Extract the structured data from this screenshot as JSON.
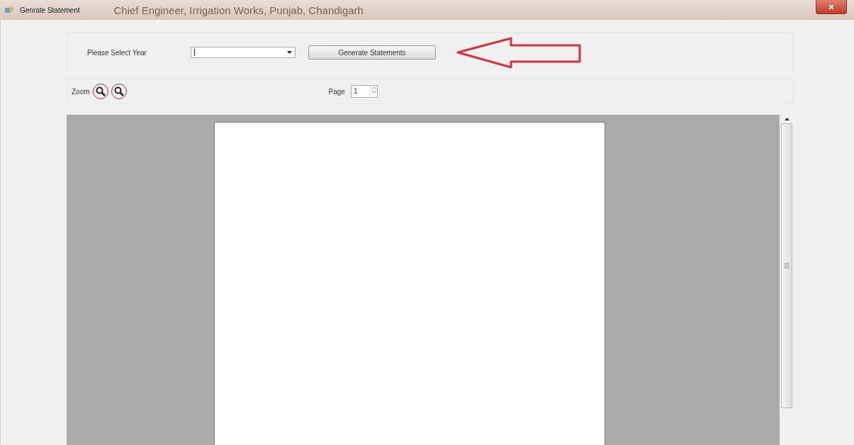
{
  "window": {
    "title": "Genrate Statement",
    "background_title": "Chief Engineer, Irrigation Works, Punjab, Chandigarh"
  },
  "year_select": {
    "label": "Please Select Year",
    "button": "Generate Statements"
  },
  "toolbar": {
    "zoom_label": "Zoom",
    "page_label": "Page",
    "page_value": "1"
  }
}
